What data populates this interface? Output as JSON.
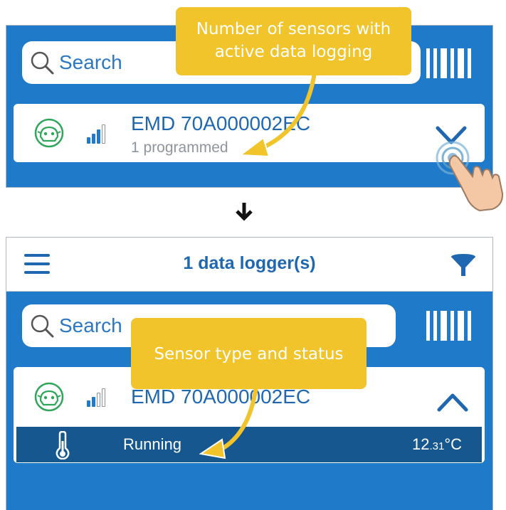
{
  "top_view": {
    "search": {
      "placeholder": "Search",
      "icon": "search-icon"
    },
    "barcode_icon": "barcode-scan-icon",
    "device": {
      "name": "EMD 70A000002EC",
      "subtitle": "1 programmed",
      "status_icon": "robot-icon",
      "signal_icon": "signal-strength-icon",
      "signal_level": 0.75,
      "expand_icon": "chevron-down-icon"
    },
    "tap_hint_icon": "tap-hand-icon",
    "callout": "Number of sensors with active data logging"
  },
  "transition_icon": "arrow-down-icon",
  "bottom_view": {
    "appbar": {
      "title": "1 data logger(s)",
      "menu_icon": "hamburger-menu-icon",
      "filter_icon": "filter-icon"
    },
    "search": {
      "placeholder": "Search",
      "icon": "search-icon"
    },
    "barcode_icon": "barcode-scan-icon",
    "device": {
      "name": "EMD 70A000002EC",
      "status_icon": "robot-icon",
      "signal_icon": "signal-strength-icon",
      "signal_level": 0.5,
      "collapse_icon": "chevron-up-icon"
    },
    "sensor": {
      "icon": "thermometer-icon",
      "status": "Running",
      "value_main": "12",
      "value_decimal": ".31",
      "unit": "°C"
    },
    "callout": "Sensor type and status"
  },
  "colors": {
    "panel_blue": "#1f7bc9",
    "text_blue": "#1f67b0",
    "sensor_row": "#17578f",
    "callout_yellow": "#f0c42a",
    "robot_green": "#2fa65a"
  }
}
